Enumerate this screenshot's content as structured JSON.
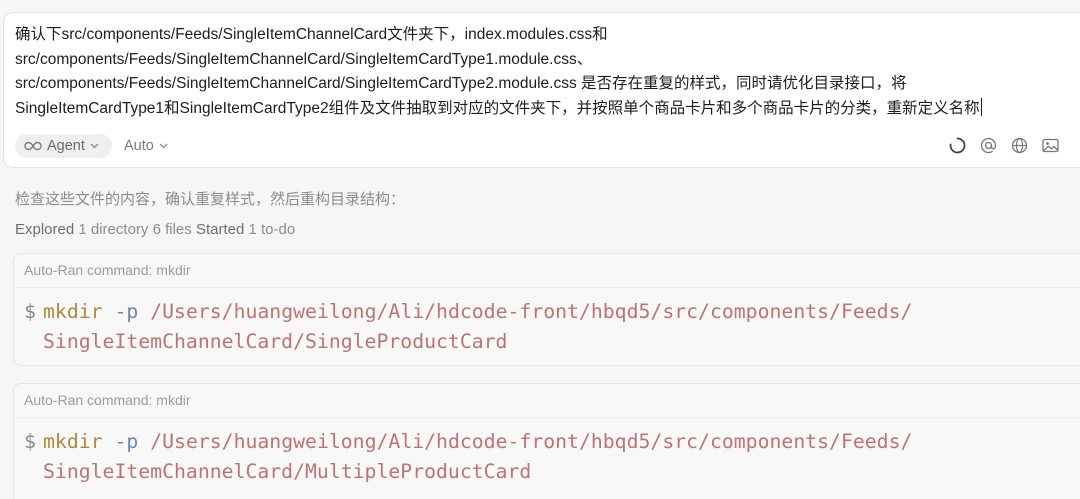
{
  "prompt": {
    "lines": [
      "确认下src/components/Feeds/SingleItemChannelCard文件夹下，index.modules.css和",
      "src/components/Feeds/SingleItemChannelCard/SingleItemCardType1.module.css、",
      "src/components/Feeds/SingleItemChannelCard/SingleItemCardType2.module.css 是否存在重复的样式，同时请优化目录接口，将",
      "SingleItemCardType1和SingleItemCardType2组件及文件抽取到对应的文件夹下，并按照单个商品卡片和多个商品卡片的分类，重新定义名称"
    ]
  },
  "controls": {
    "mode_label": "Agent",
    "model_label": "Auto",
    "icons": [
      "loading-spinner-icon",
      "at-sign-icon",
      "globe-icon",
      "image-icon"
    ]
  },
  "response": {
    "intro": "检查这些文件的内容，确认重复样式，然后重构目录结构：",
    "activity": {
      "explored_label": "Explored",
      "explored_detail": "1 directory 6 files",
      "started_label": "Started",
      "started_detail": "1 to-do"
    }
  },
  "commands": [
    {
      "header": "Auto-Ran command: mkdir",
      "prompt_symbol": "$",
      "bin": "mkdir",
      "flag": "-p",
      "path_line1": "/Users/huangweilong/Ali/hdcode-front/hbqd5/src/components/Feeds/",
      "path_line2": "SingleItemChannelCard/SingleProductCard"
    },
    {
      "header": "Auto-Ran command: mkdir",
      "prompt_symbol": "$",
      "bin": "mkdir",
      "flag": "-p",
      "path_line1": "/Users/huangweilong/Ali/hdcode-front/hbqd5/src/components/Feeds/",
      "path_line2": "SingleItemChannelCard/MultipleProductCard"
    }
  ],
  "colors": {
    "bin": "#b08a3c",
    "flag": "#6a88b4",
    "path": "#c07272"
  }
}
